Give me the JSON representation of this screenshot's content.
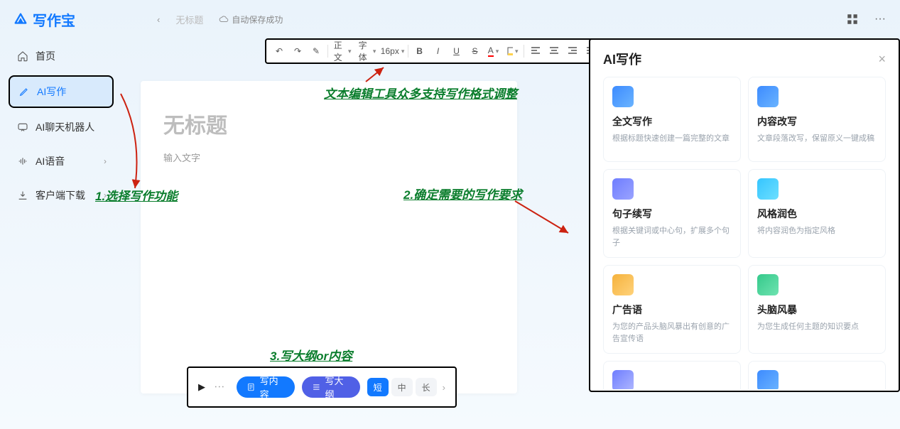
{
  "app": {
    "name": "写作宝"
  },
  "header": {
    "back_char": "‹",
    "tab_title": "无标题",
    "autosave": "自动保存成功",
    "grid_icon": "grid",
    "more_icon": "···"
  },
  "sidebar": {
    "items": [
      {
        "icon": "home",
        "label": "首页",
        "active": false,
        "expandable": false
      },
      {
        "icon": "pencil",
        "label": "AI写作",
        "active": true,
        "expandable": false
      },
      {
        "icon": "chat",
        "label": "AI聊天机器人",
        "active": false,
        "expandable": false
      },
      {
        "icon": "voice",
        "label": "AI语音",
        "active": false,
        "expandable": true
      },
      {
        "icon": "download",
        "label": "客户端下载",
        "active": false,
        "expandable": true
      }
    ]
  },
  "toolbar": {
    "undo": "↶",
    "redo": "↷",
    "format": "✎",
    "paragraph": "正文",
    "font": "字体",
    "size": "16px",
    "bold": "B",
    "italic": "I",
    "underline": "U",
    "strike": "S",
    "color": "A",
    "highlight": "bg",
    "align_l": "≡",
    "align_c": "≡",
    "align_r": "≡",
    "align_j": "≡",
    "list_ul": "≣",
    "list_ol": "≣",
    "indent": "≣"
  },
  "document": {
    "title_placeholder": "无标题",
    "body_placeholder": "输入文字"
  },
  "bottom": {
    "anchor": "▶",
    "dots": "⋮",
    "write_content": "写内容",
    "write_outline": "写大纲",
    "length": {
      "short": "短",
      "medium": "中",
      "long": "长",
      "active": "short"
    },
    "arrow": "›"
  },
  "panel": {
    "title": "AI写作",
    "close": "×",
    "cards": [
      {
        "color": "#3d8bff",
        "title": "全文写作",
        "desc": "根据标题快速创建一篇完整的文章"
      },
      {
        "color": "#3d8bff",
        "title": "内容改写",
        "desc": "文章段落改写，保留原义一键成稿"
      },
      {
        "color": "#6e7dff",
        "title": "句子续写",
        "desc": "根据关键词或中心句，扩展多个句子"
      },
      {
        "color": "#35c5ff",
        "title": "风格润色",
        "desc": "将内容润色为指定风格"
      },
      {
        "color": "#f5b23d",
        "title": "广告语",
        "desc": "为您的产品头脑风暴出有创意的广告宣传语"
      },
      {
        "color": "#34c98b",
        "title": "头脑风暴",
        "desc": "为您生成任何主题的知识要点"
      },
      {
        "color": "#6e7dff",
        "title": "",
        "desc": ""
      },
      {
        "color": "#3d8bff",
        "title": "",
        "desc": ""
      }
    ]
  },
  "annotations": {
    "a1": "1.选择写作功能",
    "a2": "文本编辑工具众多支持写作格式调整",
    "a3": "2.确定需要的写作要求",
    "a4": "3.写大纲or内容"
  }
}
